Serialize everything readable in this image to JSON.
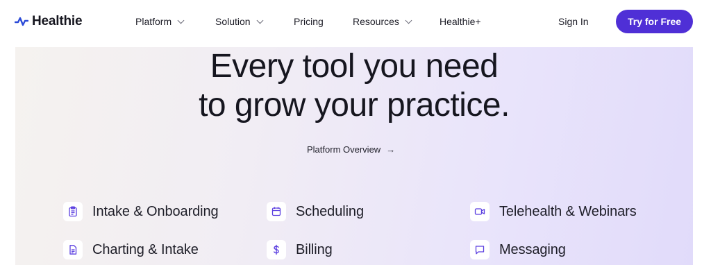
{
  "brand": {
    "name": "Healthie",
    "accent_color": "#4f2fd6",
    "logo_color": "#2b4ad8"
  },
  "nav": {
    "items": [
      {
        "label": "Platform",
        "has_dropdown": true
      },
      {
        "label": "Solution",
        "has_dropdown": true
      },
      {
        "label": "Pricing",
        "has_dropdown": false
      },
      {
        "label": "Resources",
        "has_dropdown": true
      },
      {
        "label": "Healthie+",
        "has_dropdown": false
      }
    ],
    "sign_in": "Sign In",
    "cta": "Try for Free"
  },
  "hero": {
    "title_line1": "Every tool you need",
    "title_line2": "to grow your practice.",
    "overview_link": "Platform Overview",
    "overview_arrow": "→",
    "icon_color": "#5b3fe0"
  },
  "features": [
    {
      "label": "Intake & Onboarding",
      "icon": "clipboard-icon"
    },
    {
      "label": "Scheduling",
      "icon": "calendar-icon"
    },
    {
      "label": "Telehealth & Webinars",
      "icon": "video-icon"
    },
    {
      "label": "Charting & Intake",
      "icon": "document-icon"
    },
    {
      "label": "Billing",
      "icon": "dollar-icon"
    },
    {
      "label": "Messaging",
      "icon": "chat-icon"
    }
  ]
}
